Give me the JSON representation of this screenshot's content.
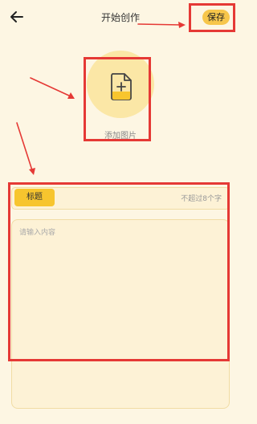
{
  "header": {
    "back_icon": "arrow-left-icon",
    "title": "开始创作",
    "save_label": "保存"
  },
  "image_picker": {
    "icon": "add-file-icon",
    "label": "添加图片"
  },
  "title_field": {
    "tag_label": "标题",
    "hint": "不超过8个字"
  },
  "content_field": {
    "placeholder": "请输入内容"
  },
  "colors": {
    "background": "#fdf6e3",
    "accent": "#f7c52e",
    "annotation": "#e53935"
  }
}
